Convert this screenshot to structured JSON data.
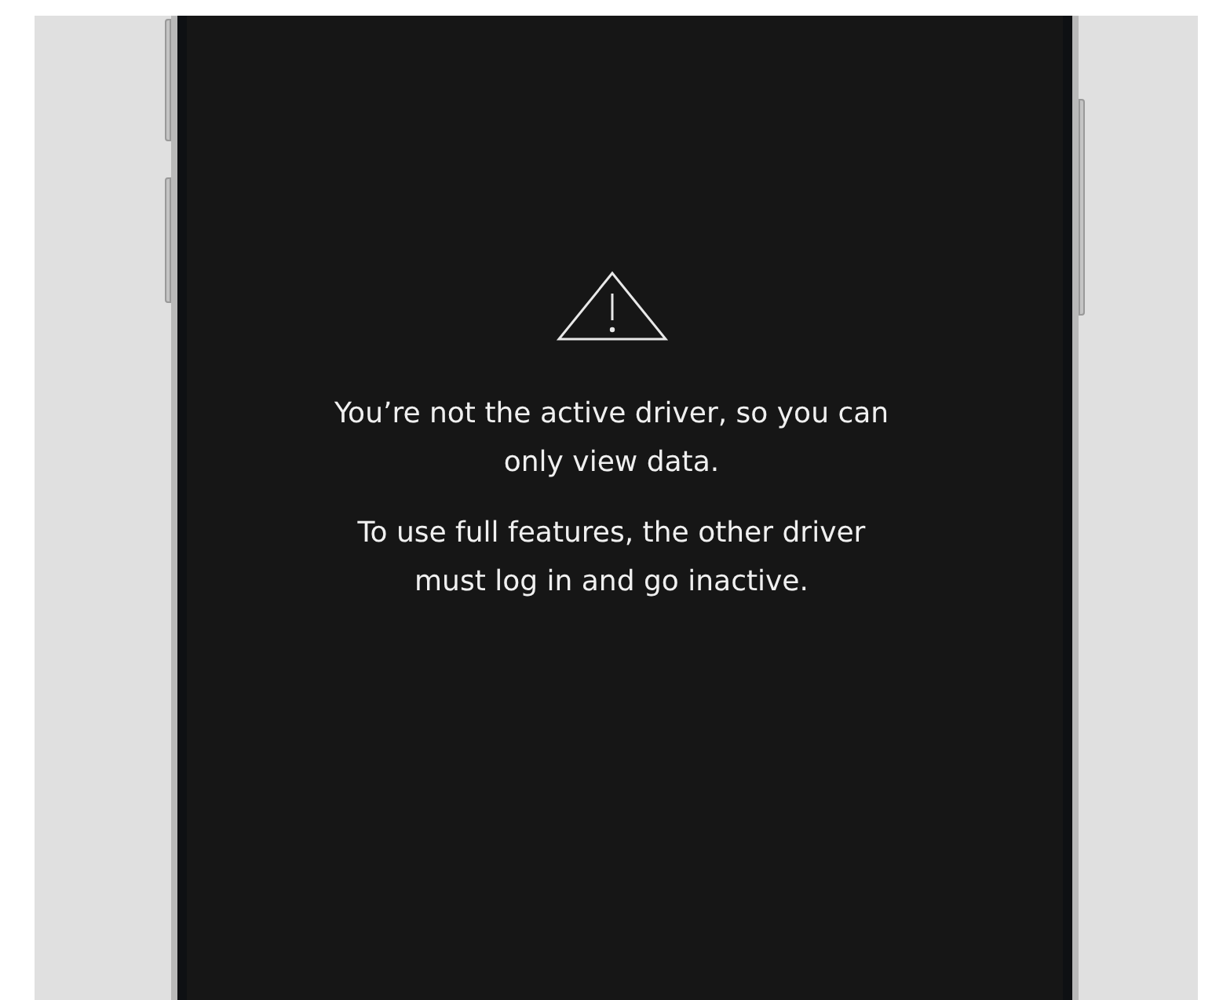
{
  "notice": {
    "paragraphs": [
      "You’re not the active driver, so you can only view data.",
      "To use full features, the other driver must log in and go inactive."
    ]
  }
}
